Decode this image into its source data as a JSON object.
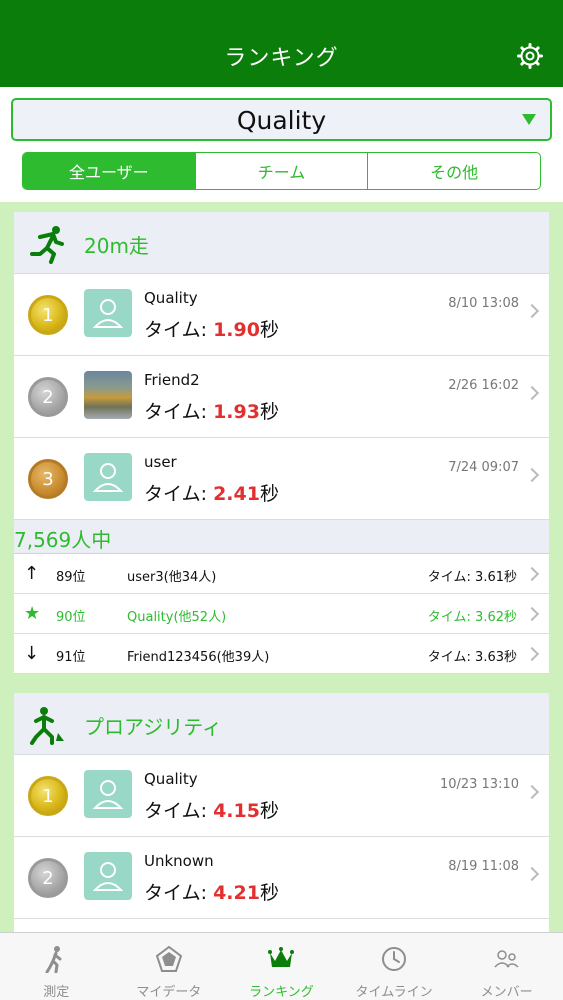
{
  "header": {
    "title": "ランキング",
    "settings_icon": "gear-icon"
  },
  "selector": {
    "value": "Quality"
  },
  "segments": [
    {
      "label": "全ユーザー",
      "active": true
    },
    {
      "label": "チーム",
      "active": false
    },
    {
      "label": "その他",
      "active": false
    }
  ],
  "sections": [
    {
      "title": "20m走",
      "icon": "sprint-icon",
      "rows": [
        {
          "rank": "1",
          "medal": "gold",
          "name": "Quality",
          "time_label": "タイム: ",
          "time_value": "1.90",
          "time_unit": "秒",
          "date": "8/10 13:08",
          "avatar": "placeholder"
        },
        {
          "rank": "2",
          "medal": "silver",
          "name": "Friend2",
          "time_label": "タイム: ",
          "time_value": "1.93",
          "time_unit": "秒",
          "date": "2/26 16:02",
          "avatar": "photo"
        },
        {
          "rank": "3",
          "medal": "bronze",
          "name": "user",
          "time_label": "タイム: ",
          "time_value": "2.41",
          "time_unit": "秒",
          "date": "7/24 09:07",
          "avatar": "placeholder"
        }
      ],
      "total": "7,569人中",
      "nearby": [
        {
          "arrow": "↑",
          "position": "89位",
          "name": "user3(他34人)",
          "time": "タイム: 3.61秒",
          "me": false
        },
        {
          "arrow": "★",
          "position": "90位",
          "name": "Quality(他52人)",
          "time": "タイム: 3.62秒",
          "me": true
        },
        {
          "arrow": "↓",
          "position": "91位",
          "name": "Friend123456(他39人)",
          "time": "タイム: 3.63秒",
          "me": false
        }
      ]
    },
    {
      "title": "プロアジリティ",
      "icon": "agility-icon",
      "rows": [
        {
          "rank": "1",
          "medal": "gold",
          "name": "Quality",
          "time_label": "タイム: ",
          "time_value": "4.15",
          "time_unit": "秒",
          "date": "10/23 13:10",
          "avatar": "placeholder"
        },
        {
          "rank": "2",
          "medal": "silver",
          "name": "Unknown",
          "time_label": "タイム: ",
          "time_value": "4.21",
          "time_unit": "秒",
          "date": "8/19 11:08",
          "avatar": "placeholder"
        }
      ]
    }
  ],
  "tabbar": [
    {
      "label": "測定",
      "icon": "walking-person-icon",
      "active": false
    },
    {
      "label": "マイデータ",
      "icon": "pentagon-chart-icon",
      "active": false
    },
    {
      "label": "ランキング",
      "icon": "crown-icon",
      "active": true
    },
    {
      "label": "タイムライン",
      "icon": "clock-icon",
      "active": false
    },
    {
      "label": "メンバー",
      "icon": "members-icon",
      "active": false
    }
  ],
  "colors": {
    "nav": "#0a7d0a",
    "accent": "#2fbb2f",
    "time_value": "#e23030",
    "background": "#cdf0bd"
  }
}
